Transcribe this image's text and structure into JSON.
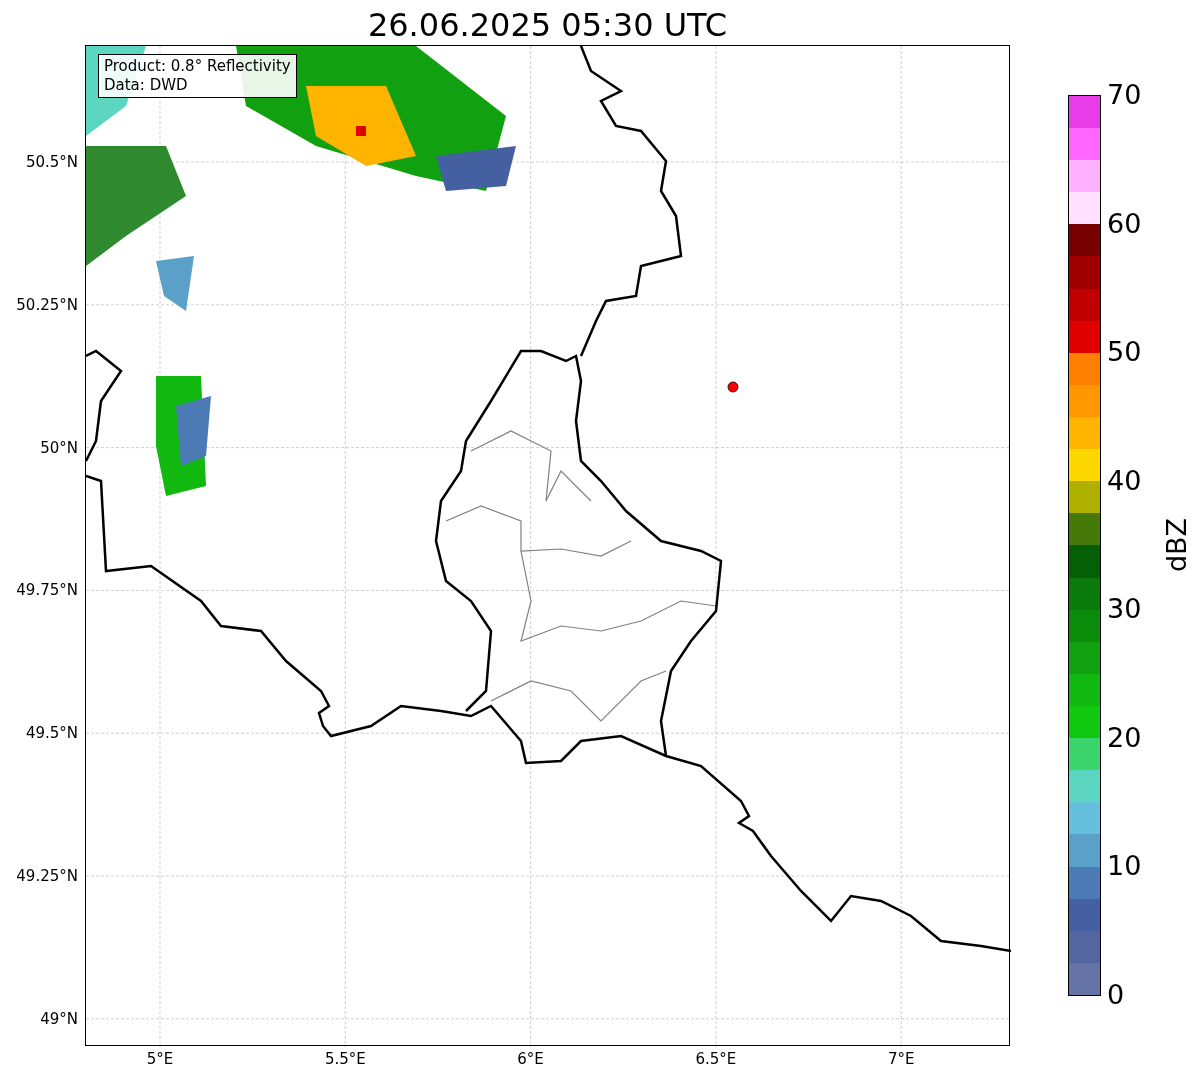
{
  "title": "26.06.2025 05:30 UTC",
  "info_box": {
    "lines": [
      "Product: 0.8° Reflectivity",
      "Data: DWD"
    ]
  },
  "y_ticks": [
    "50.5°N",
    "50.25°N",
    "50°N",
    "49.75°N",
    "49.5°N",
    "49.25°N",
    "49°N"
  ],
  "x_ticks": [
    "5°E",
    "5.5°E",
    "6°E",
    "6.5°E",
    "7°E"
  ],
  "colorbar": {
    "label": "dBZ",
    "ticks": [
      "70",
      "60",
      "50",
      "40",
      "30",
      "20",
      "10",
      "0"
    ],
    "segments": [
      {
        "color": "#6472a6"
      },
      {
        "color": "#5366a0"
      },
      {
        "color": "#4460a0"
      },
      {
        "color": "#4c7ab4"
      },
      {
        "color": "#5ba0c8"
      },
      {
        "color": "#64c0dc"
      },
      {
        "color": "#5cd6c0"
      },
      {
        "color": "#3cd46c"
      },
      {
        "color": "#10c810"
      },
      {
        "color": "#10b810"
      },
      {
        "color": "#10a010"
      },
      {
        "color": "#0a8c0a"
      },
      {
        "color": "#0a7a0a"
      },
      {
        "color": "#055f05"
      },
      {
        "color": "#457a0a"
      },
      {
        "color": "#b0b000"
      },
      {
        "color": "#ffd700"
      },
      {
        "color": "#ffb400"
      },
      {
        "color": "#ff9800"
      },
      {
        "color": "#ff7f00"
      },
      {
        "color": "#e00000"
      },
      {
        "color": "#c00000"
      },
      {
        "color": "#a00000"
      },
      {
        "color": "#780000"
      },
      {
        "color": "#ffe0ff"
      },
      {
        "color": "#ffb0ff"
      },
      {
        "color": "#ff66ff"
      },
      {
        "color": "#e83ce8"
      }
    ]
  }
}
